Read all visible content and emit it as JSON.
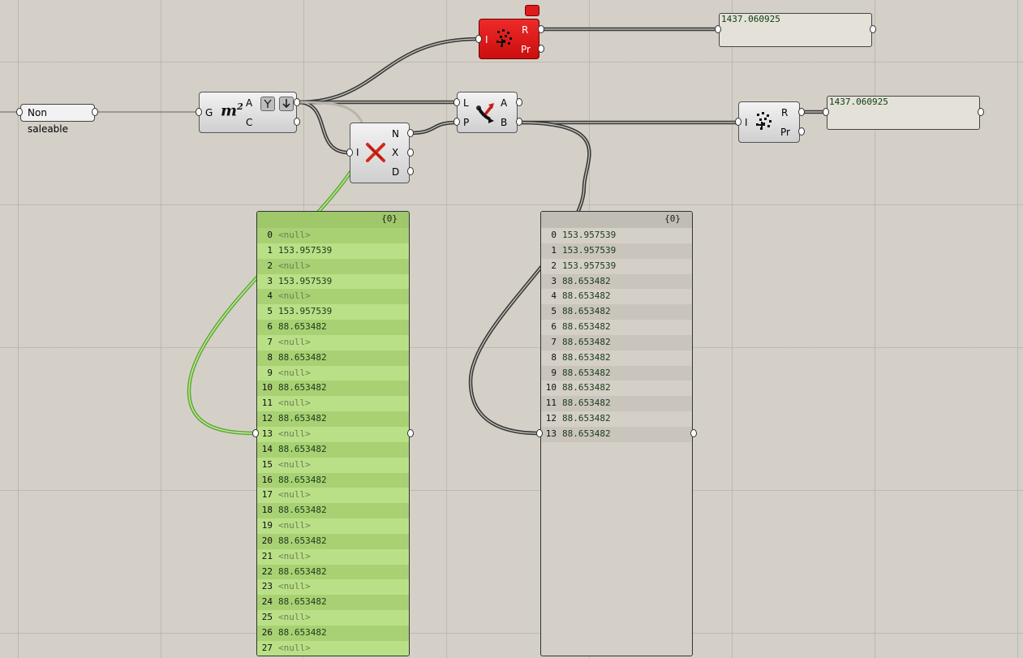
{
  "canvas": {
    "background": "#d4d0c8",
    "wire_color": "#3b3b3b",
    "wire_selected_color": "#79c24a"
  },
  "nodes": {
    "text_param": {
      "label": "Non saleable"
    },
    "area": {
      "input": "G",
      "outputs": [
        "A",
        "C"
      ],
      "icon": "m²",
      "icon_name": "area-icon",
      "flags": [
        "graft-flag-icon",
        "flatten-flag-icon"
      ]
    },
    "mass_add_top": {
      "input": "I",
      "outputs": [
        "R",
        "Pr"
      ],
      "icon_name": "mass-addition-icon",
      "state": "error",
      "state_color": "#e01b1b"
    },
    "null_item": {
      "input": "I",
      "outputs": [
        "N",
        "X",
        "D"
      ],
      "icon_name": "null-item-icon"
    },
    "dispatch": {
      "inputs": [
        "L",
        "P"
      ],
      "outputs": [
        "A",
        "B"
      ],
      "icon_name": "dispatch-icon"
    },
    "mass_add_right": {
      "input": "I",
      "outputs": [
        "R",
        "Pr"
      ],
      "icon_name": "mass-addition-icon"
    }
  },
  "panels": {
    "result_top": {
      "value": "1437.060925"
    },
    "result_right": {
      "value": "1437.060925"
    }
  },
  "data_panels": {
    "green": {
      "path": "{0}",
      "rows": [
        {
          "i": "0",
          "v": "<null>"
        },
        {
          "i": "1",
          "v": "153.957539"
        },
        {
          "i": "2",
          "v": "<null>"
        },
        {
          "i": "3",
          "v": "153.957539"
        },
        {
          "i": "4",
          "v": "<null>"
        },
        {
          "i": "5",
          "v": "153.957539"
        },
        {
          "i": "6",
          "v": "88.653482"
        },
        {
          "i": "7",
          "v": "<null>"
        },
        {
          "i": "8",
          "v": "88.653482"
        },
        {
          "i": "9",
          "v": "<null>"
        },
        {
          "i": "10",
          "v": "88.653482"
        },
        {
          "i": "11",
          "v": "<null>"
        },
        {
          "i": "12",
          "v": "88.653482"
        },
        {
          "i": "13",
          "v": "<null>"
        },
        {
          "i": "14",
          "v": "88.653482"
        },
        {
          "i": "15",
          "v": "<null>"
        },
        {
          "i": "16",
          "v": "88.653482"
        },
        {
          "i": "17",
          "v": "<null>"
        },
        {
          "i": "18",
          "v": "88.653482"
        },
        {
          "i": "19",
          "v": "<null>"
        },
        {
          "i": "20",
          "v": "88.653482"
        },
        {
          "i": "21",
          "v": "<null>"
        },
        {
          "i": "22",
          "v": "88.653482"
        },
        {
          "i": "23",
          "v": "<null>"
        },
        {
          "i": "24",
          "v": "88.653482"
        },
        {
          "i": "25",
          "v": "<null>"
        },
        {
          "i": "26",
          "v": "88.653482"
        },
        {
          "i": "27",
          "v": "<null>"
        }
      ]
    },
    "grey": {
      "path": "{0}",
      "rows": [
        {
          "i": "0",
          "v": "153.957539"
        },
        {
          "i": "1",
          "v": "153.957539"
        },
        {
          "i": "2",
          "v": "153.957539"
        },
        {
          "i": "3",
          "v": "88.653482"
        },
        {
          "i": "4",
          "v": "88.653482"
        },
        {
          "i": "5",
          "v": "88.653482"
        },
        {
          "i": "6",
          "v": "88.653482"
        },
        {
          "i": "7",
          "v": "88.653482"
        },
        {
          "i": "8",
          "v": "88.653482"
        },
        {
          "i": "9",
          "v": "88.653482"
        },
        {
          "i": "10",
          "v": "88.653482"
        },
        {
          "i": "11",
          "v": "88.653482"
        },
        {
          "i": "12",
          "v": "88.653482"
        },
        {
          "i": "13",
          "v": "88.653482"
        }
      ]
    }
  }
}
